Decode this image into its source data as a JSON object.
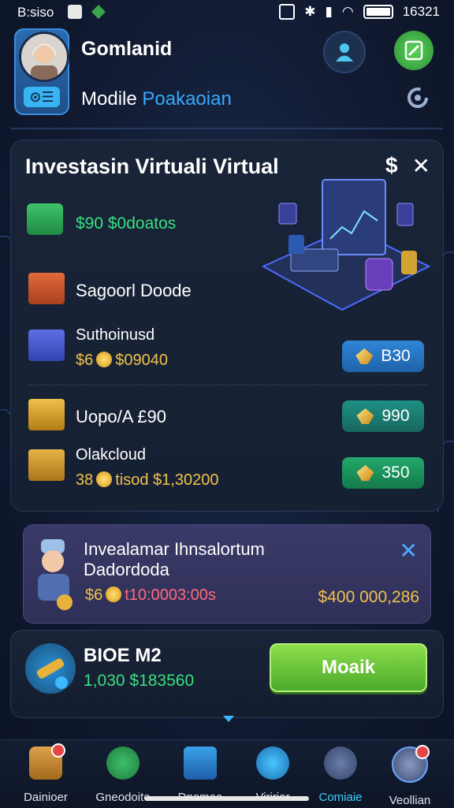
{
  "status_bar": {
    "time": "B:siso",
    "clock": "16321"
  },
  "header": {
    "user_name": "Gomlanid",
    "subtitle_lead": "Modile",
    "subtitle_accent": "Poakaoian"
  },
  "card": {
    "title": "Investasin Virtuali Virtual",
    "dollar_symbol": "$",
    "close_symbol": "✕",
    "rows": [
      {
        "price": "$90 $0doatos"
      },
      {
        "label": "Sagoorl Doode"
      },
      {
        "label": "Suthoinusd",
        "amount_lead": "$6",
        "amount_rest": "$09040",
        "button": "B30"
      },
      {
        "label": "Uopo/A £90",
        "button": "990"
      },
      {
        "label": "Olakcloud",
        "amount_lead": "38",
        "amount_rest": "tisod $1,30200",
        "button": "350"
      }
    ]
  },
  "notice": {
    "title": "Invealamar Ihnsalortum",
    "subtitle": "Dadordoda",
    "amount_lead": "$6",
    "amount_rest": "t10:0003:00s",
    "total": "$400 000,286",
    "close_symbol": "✕"
  },
  "bottom_panel": {
    "title": "BIOE M2",
    "value": "1,030 $183560",
    "cta_label": "Moaik"
  },
  "nav": {
    "items": [
      {
        "label": "Dainioer",
        "icon": "home-icon"
      },
      {
        "label": "Gneodoite",
        "icon": "clock-icon"
      },
      {
        "label": "Dnomoo",
        "icon": "chart-icon"
      },
      {
        "label": "Viririar",
        "icon": "dollar-icon"
      },
      {
        "label": "Comiaie",
        "icon": "city-icon"
      },
      {
        "label": "Veollian",
        "icon": "profile-icon"
      }
    ]
  }
}
